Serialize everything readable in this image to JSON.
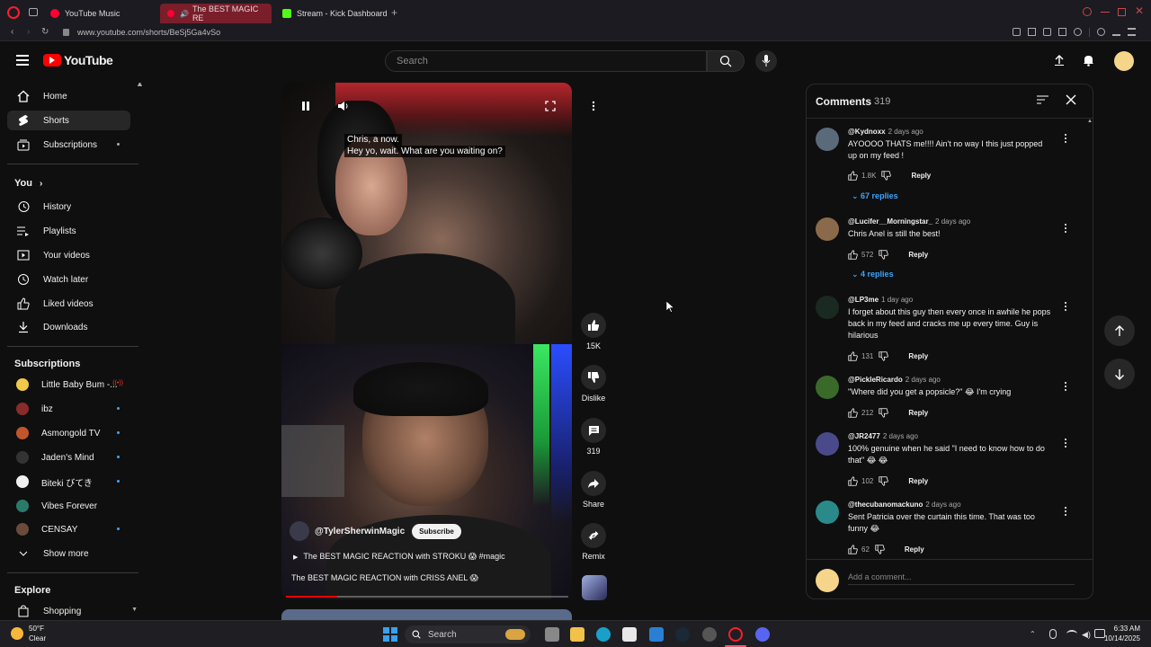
{
  "browser": {
    "tabs": [
      {
        "label": "YouTube Music",
        "icon": "youtube-music-icon"
      },
      {
        "label": "The BEST MAGIC RE",
        "icon": "audio-playing-icon",
        "active": true
      },
      {
        "label": "Stream - Kick Dashboard",
        "icon": "kick-icon"
      }
    ],
    "url": "www.youtube.com/shorts/BeSj5Ga4vSo"
  },
  "header": {
    "logo_text": "YouTube",
    "search_placeholder": "Search"
  },
  "sidebar": {
    "main": [
      {
        "label": "Home",
        "icon": "home-icon"
      },
      {
        "label": "Shorts",
        "icon": "shorts-icon",
        "active": true
      },
      {
        "label": "Subscriptions",
        "icon": "subscriptions-icon"
      }
    ],
    "you_title": "You",
    "you": [
      {
        "label": "History",
        "icon": "history-icon"
      },
      {
        "label": "Playlists",
        "icon": "playlists-icon"
      },
      {
        "label": "Your videos",
        "icon": "your-videos-icon"
      },
      {
        "label": "Watch later",
        "icon": "watch-later-icon"
      },
      {
        "label": "Liked videos",
        "icon": "liked-videos-icon"
      },
      {
        "label": "Downloads",
        "icon": "downloads-icon"
      }
    ],
    "subscriptions_title": "Subscriptions",
    "subscriptions": [
      {
        "label": "Little Baby Bum -...",
        "color": "#f2c84b"
      },
      {
        "label": "ibz",
        "color": "#8a2b2b"
      },
      {
        "label": "Asmongold TV",
        "color": "#c0562a"
      },
      {
        "label": "Jaden's Mind",
        "color": "#333333"
      },
      {
        "label": "Biteki びてき",
        "color": "#f0f0f0"
      },
      {
        "label": "Vibes Forever",
        "color": "#2a7a6a"
      },
      {
        "label": "CENSAY",
        "color": "#6a4a3a"
      }
    ],
    "show_more": "Show more",
    "explore_title": "Explore",
    "explore": [
      {
        "label": "Shopping",
        "icon": "shopping-icon"
      }
    ]
  },
  "video": {
    "caption_line1": "Chris, a now.",
    "caption_line2": "Hey yo, wait. What are you waiting on?",
    "channel": "@TylerSherwinMagic",
    "subscribe": "Subscribe",
    "playlist_title": "The BEST MAGIC REACTION with STROKU 😱 #magic",
    "title": "The BEST MAGIC REACTION with CRISS ANEL 😱",
    "progress": 0.18
  },
  "actions": {
    "likes": "15K",
    "dislike": "Dislike",
    "comments": "319",
    "share": "Share",
    "remix": "Remix"
  },
  "comments": {
    "title": "Comments",
    "count": "319",
    "items": [
      {
        "author": "@Kydnoxx",
        "time": "2 days ago",
        "text": "AYOOOO THATS me!!!! Ain't no way I this just popped up on my feed !",
        "likes": "1.8K",
        "replies": "67 replies",
        "avatar": "#5a6a7a"
      },
      {
        "author": "@Lucifer__Morningstar_",
        "time": "2 days ago",
        "text": "Chris Anel is still the best!",
        "likes": "572",
        "replies": "4 replies",
        "avatar": "#8a6a4a"
      },
      {
        "author": "@LP3me",
        "time": "1 day ago",
        "text": "I forget about this guy then every once in awhile he pops back in my feed and cracks me up every time. Guy is hilarious",
        "likes": "131",
        "replies": "",
        "avatar": "#1a2a22"
      },
      {
        "author": "@PickleRicardo",
        "time": "2 days ago",
        "text": "\"Where did you get a popsicle?\" 😂 I'm crying",
        "likes": "212",
        "replies": "",
        "avatar": "#3a6a2a"
      },
      {
        "author": "@JR2477",
        "time": "2 days ago",
        "text": "100% genuine when he said \"I need to know how to do that\" 😂 😂",
        "likes": "102",
        "replies": "",
        "avatar": "#4a4a8a"
      },
      {
        "author": "@thecubanomackuno",
        "time": "2 days ago",
        "text": "Sent Patricia over the curtain this time. That was too funny 😂",
        "likes": "62",
        "replies": "",
        "avatar": "#2a8a8a"
      }
    ],
    "reply_label": "Reply",
    "add_placeholder": "Add a comment..."
  },
  "taskbar": {
    "weather_temp": "50°F",
    "weather_desc": "Clear",
    "search": "Search",
    "time": "6:33 AM",
    "date": "10/14/2025"
  },
  "colors": {
    "accent": "#ff0000",
    "link": "#3ea6ff",
    "bg": "#0f0f0f"
  }
}
